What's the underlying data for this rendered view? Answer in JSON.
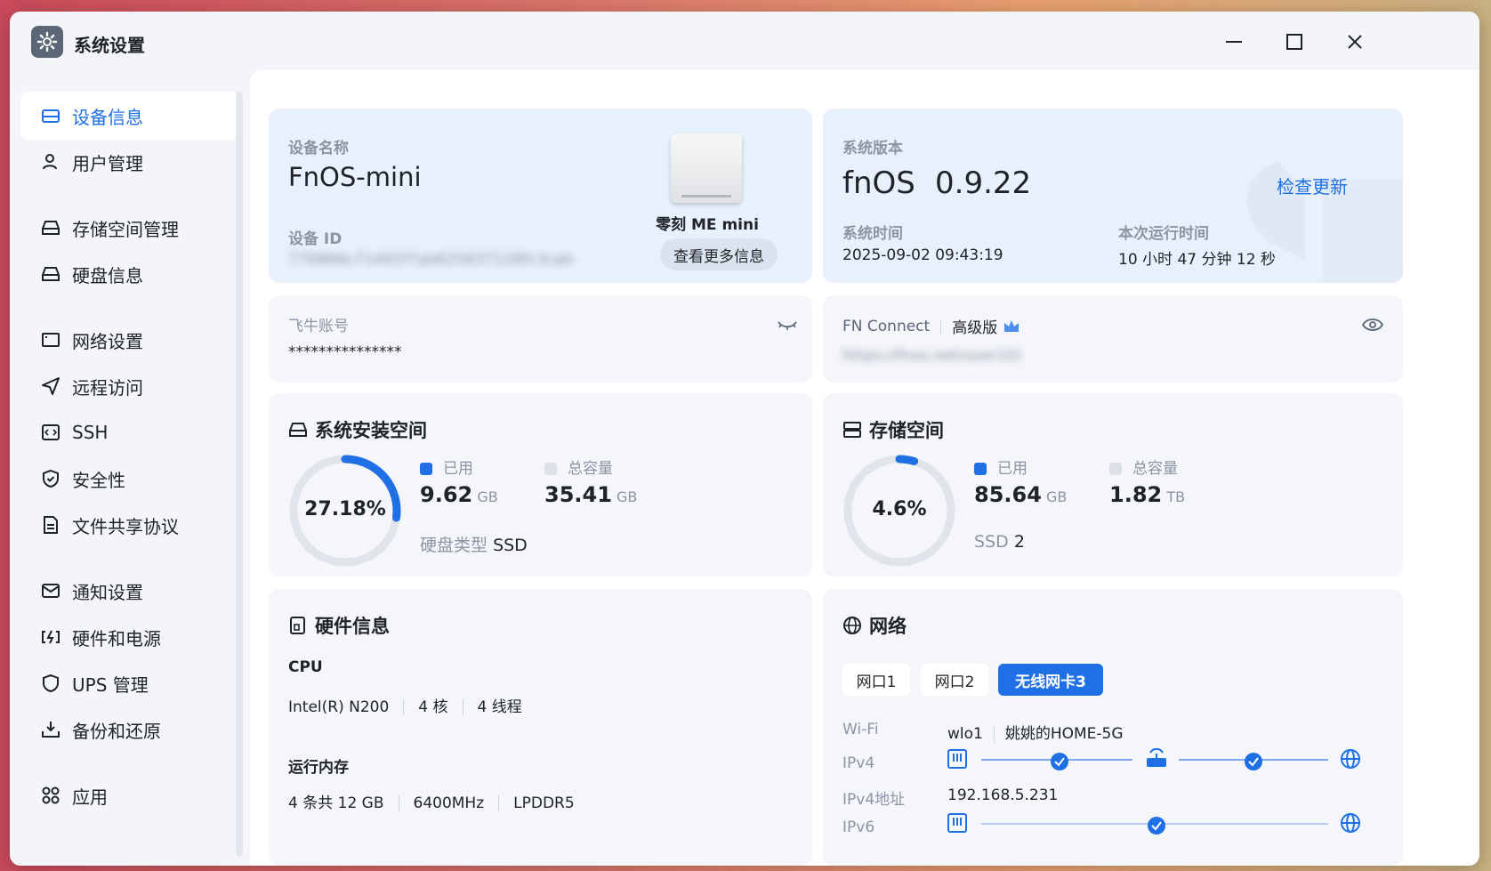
{
  "window": {
    "title": "系统设置"
  },
  "sidebar": {
    "items": [
      {
        "label": "设备信息"
      },
      {
        "label": "用户管理"
      },
      {
        "label": "存储空间管理"
      },
      {
        "label": "硬盘信息"
      },
      {
        "label": "网络设置"
      },
      {
        "label": "远程访问"
      },
      {
        "label": "SSH"
      },
      {
        "label": "安全性"
      },
      {
        "label": "文件共享协议"
      },
      {
        "label": "通知设置"
      },
      {
        "label": "硬件和电源"
      },
      {
        "label": "UPS 管理"
      },
      {
        "label": "备份和还原"
      },
      {
        "label": "应用"
      }
    ]
  },
  "device": {
    "name_label": "设备名称",
    "name": "FnOS-mini",
    "id_label": "设备 ID",
    "id_value": "770866c71491f7ab625637128fc3cab",
    "model": "零刻 ME mini",
    "more_button": "查看更多信息"
  },
  "system": {
    "version_label": "系统版本",
    "os_name": "fnOS",
    "version": "0.9.22",
    "check_update": "检查更新",
    "time_label": "系统时间",
    "time": "2025-09-02 09:43:19",
    "uptime_label": "本次运行时间",
    "uptime": "10 小时 47 分钟 12 秒"
  },
  "account": {
    "label": "飞牛账号",
    "value": "***************"
  },
  "fnconnect": {
    "label": "FN Connect",
    "tier": "高级版",
    "url": "https://fnos.net/user10X"
  },
  "sys_space": {
    "title": "系统安装空间",
    "percent_text": "27.18%",
    "percent": 27.18,
    "used_label": "已用",
    "used_value": "9.62",
    "used_unit": "GB",
    "total_label": "总容量",
    "total_value": "35.41",
    "total_unit": "GB",
    "disk_type_label": "硬盘类型",
    "disk_type": "SSD"
  },
  "storage": {
    "title": "存储空间",
    "percent_text": "4.6%",
    "percent": 4.6,
    "used_label": "已用",
    "used_value": "85.64",
    "used_unit": "GB",
    "total_label": "总容量",
    "total_value": "1.82",
    "total_unit": "TB",
    "ssd_label": "SSD",
    "ssd_count": "2"
  },
  "hardware": {
    "title": "硬件信息",
    "cpu_label": "CPU",
    "cpu_model": "Intel(R) N200",
    "cpu_cores": "4 核",
    "cpu_threads": "4 线程",
    "mem_label": "运行内存",
    "mem_size": "4 条共 12 GB",
    "mem_speed": "6400MHz",
    "mem_type": "LPDDR5"
  },
  "network": {
    "title": "网络",
    "tabs": [
      {
        "label": "网口1"
      },
      {
        "label": "网口2"
      },
      {
        "label": "无线网卡3"
      }
    ],
    "wifi_label": "Wi-Fi",
    "wifi_iface": "wlo1",
    "wifi_ssid": "姚姚的HOME-5G",
    "ipv4_label": "IPv4",
    "ipv4_addr_label": "IPv4地址",
    "ipv4_addr": "192.168.5.231",
    "ipv6_label": "IPv6"
  },
  "colors": {
    "accent": "#1f6fe5",
    "ring_track": "#e1e4ea",
    "card_bg": "#f4f6fa",
    "card_blue": "#e8f0fb"
  }
}
